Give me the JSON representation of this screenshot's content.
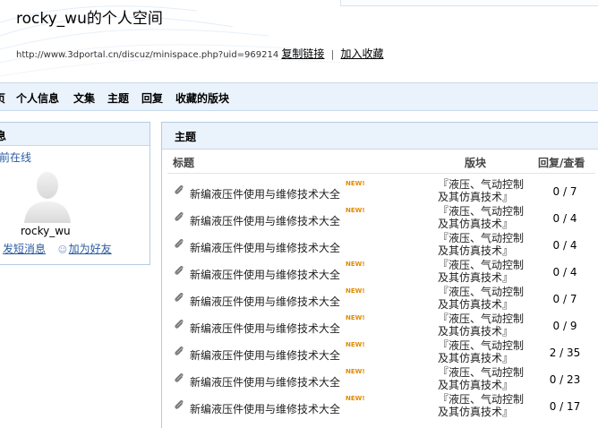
{
  "header": {
    "title": "rocky_wu的个人空间",
    "url": "http://www.3dportal.cn/discuz/minispace.php?uid=969214",
    "copy_link": "复制链接",
    "separator": "|",
    "add_favorite": "加入收藏"
  },
  "nav": {
    "items": [
      "页",
      "个人信息",
      "文集",
      "主题",
      "回复",
      "收藏的版块"
    ]
  },
  "left_panel": {
    "title": "息",
    "status": "前在线",
    "username": "rocky_wu",
    "send_message": "发短消息",
    "add_friend": "加为好友"
  },
  "main_panel": {
    "title": "主题",
    "columns": {
      "title": "标题",
      "forum": "版块",
      "stats": "回复/查看"
    },
    "new_badge": "NEW!",
    "rows": [
      {
        "subject": "新编液压件使用与维修技术大全",
        "is_new": true,
        "forum_line1": "『液压、气动控制",
        "forum_line2": "及其仿真技术』",
        "stats": "0 / 7"
      },
      {
        "subject": "新编液压件使用与维修技术大全",
        "is_new": true,
        "forum_line1": "『液压、气动控制",
        "forum_line2": "及其仿真技术』",
        "stats": "0 / 4"
      },
      {
        "subject": "新编液压件使用与维修技术大全",
        "is_new": false,
        "forum_line1": "『液压、气动控制",
        "forum_line2": "及其仿真技术』",
        "stats": "0 / 4"
      },
      {
        "subject": "新编液压件使用与维修技术大全",
        "is_new": true,
        "forum_line1": "『液压、气动控制",
        "forum_line2": "及其仿真技术』",
        "stats": "0 / 4"
      },
      {
        "subject": "新编液压件使用与维修技术大全",
        "is_new": true,
        "forum_line1": "『液压、气动控制",
        "forum_line2": "及其仿真技术』",
        "stats": "0 / 7"
      },
      {
        "subject": "新编液压件使用与维修技术大全",
        "is_new": true,
        "forum_line1": "『液压、气动控制",
        "forum_line2": "及其仿真技术』",
        "stats": "0 / 9"
      },
      {
        "subject": "新编液压件使用与维修技术大全",
        "is_new": true,
        "forum_line1": "『液压、气动控制",
        "forum_line2": "及其仿真技术』",
        "stats": "2 / 35"
      },
      {
        "subject": "新编液压件使用与维修技术大全",
        "is_new": true,
        "forum_line1": "『液压、气动控制",
        "forum_line2": "及其仿真技术』",
        "stats": "0 / 23"
      },
      {
        "subject": "新编液压件使用与维修技术大全",
        "is_new": true,
        "forum_line1": "『液压、气动控制",
        "forum_line2": "及其仿真技术』",
        "stats": "0 / 17"
      }
    ]
  },
  "icons": {
    "attachment": "paperclip-icon",
    "avatar": "default-avatar-icon",
    "message": "envelope-icon",
    "friend": "add-friend-icon"
  },
  "colors": {
    "accent_blue": "#2a5aa0",
    "panel_header": "#eaf2fb",
    "border": "#b6cce2",
    "new_badge": "#e08a00"
  }
}
